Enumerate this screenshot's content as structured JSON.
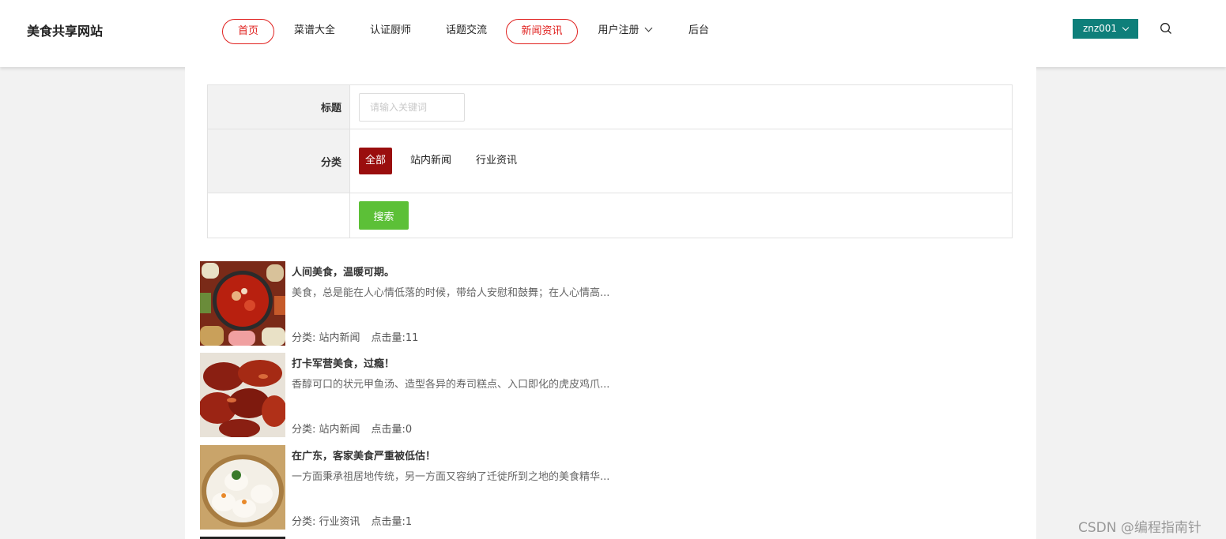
{
  "header": {
    "logo": "美食共享网站",
    "nav": [
      {
        "label": "首页",
        "circled": true
      },
      {
        "label": "菜谱大全",
        "circled": false
      },
      {
        "label": "认证厨师",
        "circled": false
      },
      {
        "label": "话题交流",
        "circled": false
      },
      {
        "label": "新闻资讯",
        "circled": true
      },
      {
        "label": "用户注册",
        "circled": false
      },
      {
        "label": "后台",
        "circled": false
      }
    ],
    "user": "znz001"
  },
  "filter": {
    "title_label": "标题",
    "title_placeholder": "请输入关键词",
    "category_label": "分类",
    "categories": [
      "全部",
      "站内新闻",
      "行业资讯"
    ],
    "active_category": "全部",
    "search_label": "搜索"
  },
  "news": [
    {
      "title": "人间美食，温暖可期。",
      "desc": "美食，总是能在人心情低落的时候，带给人安慰和鼓舞；在人心情高...",
      "category": "分类: 站内新闻",
      "clicks": "点击量:11"
    },
    {
      "title": "打卡军营美食，过瘾！",
      "desc": "香醇可口的状元甲鱼汤、造型各异的寿司糕点、入口即化的虎皮鸡爪...",
      "category": "分类: 站内新闻",
      "clicks": "点击量:0"
    },
    {
      "title": "在广东，客家美食严重被低估！",
      "desc": "一方面秉承祖居地传统，另一方面又容纳了迁徙所到之地的美食精华...",
      "category": "分类: 行业资讯",
      "clicks": "点击量:1"
    }
  ],
  "watermark": "CSDN @编程指南针",
  "colors": {
    "accent_red": "#e0201e",
    "active_category": "#9a0e0e",
    "search_green": "#5cc037",
    "user_teal": "#0e7f7a"
  }
}
